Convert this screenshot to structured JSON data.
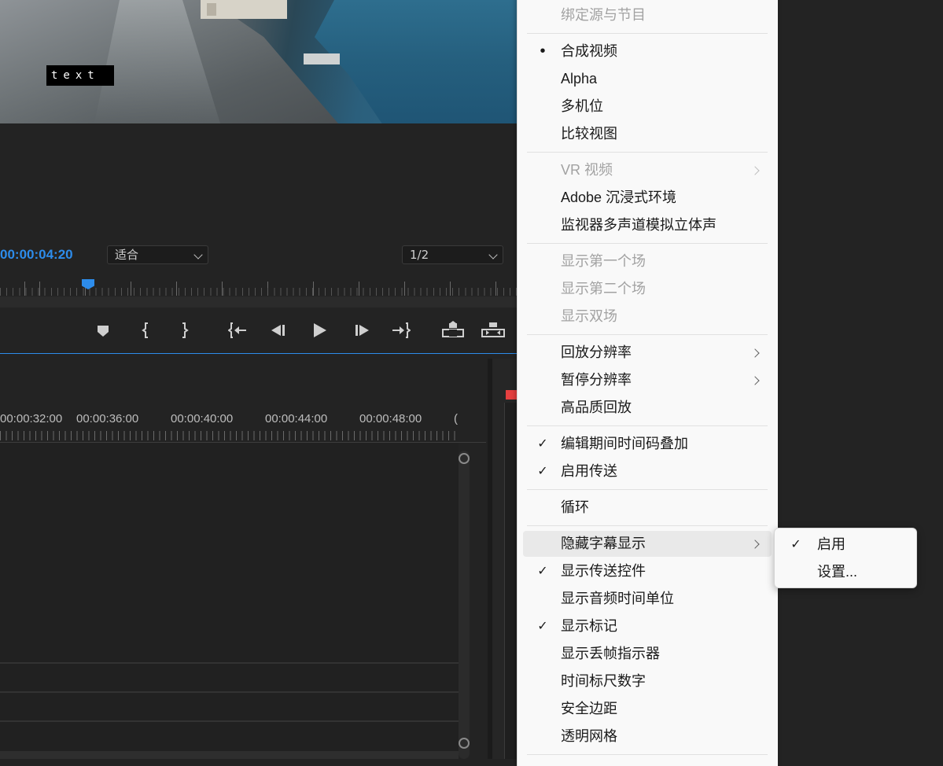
{
  "monitor": {
    "overlay_text": "text",
    "timecode": "00:00:04:20",
    "zoom_select": "适合",
    "resolution_select": "1/2"
  },
  "transport": {
    "buttons": [
      "add-marker",
      "mark-in",
      "mark-out",
      "go-to-in",
      "step-back",
      "play",
      "step-forward",
      "go-to-out",
      "lift",
      "extract"
    ]
  },
  "timeline": {
    "ruler_labels": [
      "00:00:32:00",
      "00:00:36:00",
      "00:00:40:00",
      "00:00:44:00",
      "00:00:48:00",
      "("
    ]
  },
  "context_menu": {
    "items": [
      {
        "label": "绑定源与节目",
        "enabled": false
      },
      {
        "label": "合成视频",
        "mark": "•"
      },
      {
        "label": "Alpha"
      },
      {
        "label": "多机位"
      },
      {
        "label": "比较视图"
      },
      {
        "label": "VR 视频",
        "enabled": false,
        "submenu": true
      },
      {
        "label": "Adobe 沉浸式环境"
      },
      {
        "label": "监视器多声道模拟立体声"
      },
      {
        "label": "显示第一个场",
        "enabled": false
      },
      {
        "label": "显示第二个场",
        "enabled": false
      },
      {
        "label": "显示双场",
        "enabled": false
      },
      {
        "label": "回放分辨率",
        "submenu": true
      },
      {
        "label": "暂停分辨率",
        "submenu": true
      },
      {
        "label": "高品质回放"
      },
      {
        "label": "编辑期间时间码叠加",
        "mark": "✓"
      },
      {
        "label": "启用传送",
        "mark": "✓"
      },
      {
        "label": "循环"
      },
      {
        "label": "隐藏字幕显示",
        "submenu": true,
        "highlighted": true
      },
      {
        "label": "显示传送控件",
        "mark": "✓"
      },
      {
        "label": "显示音频时间单位"
      },
      {
        "label": "显示标记",
        "mark": "✓"
      },
      {
        "label": "显示丢帧指示器"
      },
      {
        "label": "时间标尺数字"
      },
      {
        "label": "安全边距"
      },
      {
        "label": "透明网格"
      }
    ]
  },
  "submenu": {
    "items": [
      {
        "label": "启用",
        "mark": "✓"
      },
      {
        "label": "设置..."
      }
    ]
  }
}
